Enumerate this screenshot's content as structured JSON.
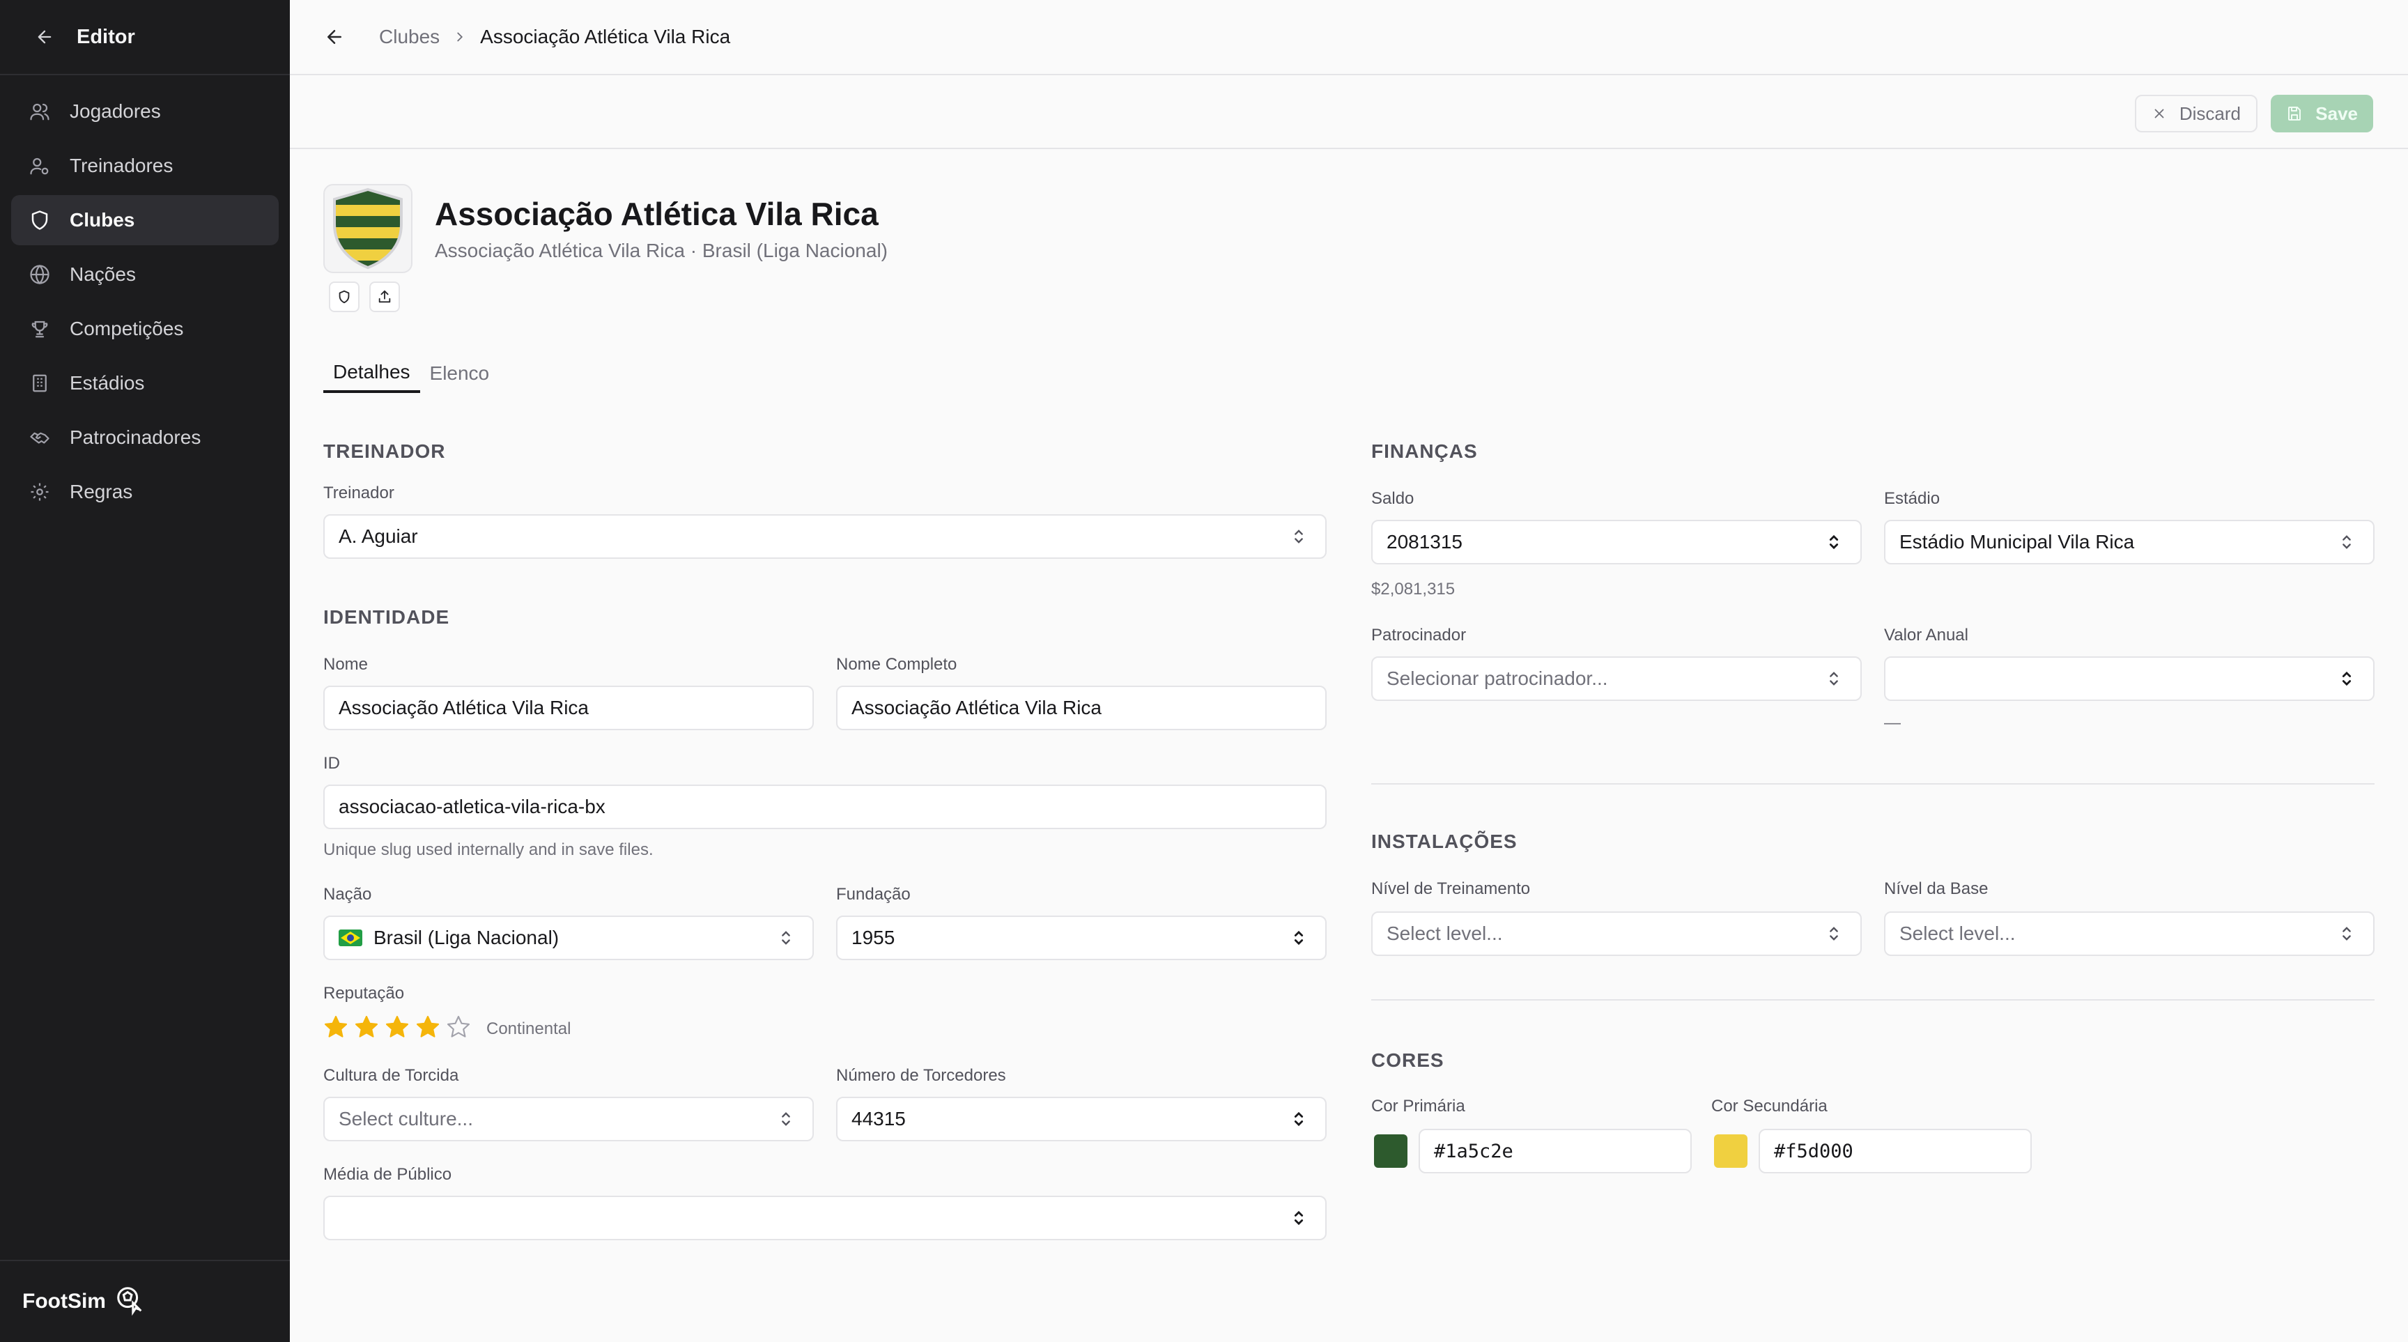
{
  "sidebar": {
    "title": "Editor",
    "items": [
      {
        "label": "Jogadores",
        "icon": "users-icon"
      },
      {
        "label": "Treinadores",
        "icon": "user-cog-icon"
      },
      {
        "label": "Clubes",
        "icon": "shield-icon",
        "active": true
      },
      {
        "label": "Nações",
        "icon": "globe-icon"
      },
      {
        "label": "Competições",
        "icon": "trophy-icon"
      },
      {
        "label": "Estádios",
        "icon": "building-icon"
      },
      {
        "label": "Patrocinadores",
        "icon": "handshake-icon"
      },
      {
        "label": "Regras",
        "icon": "gear-icon"
      }
    ],
    "footer_brand": "FootSim"
  },
  "breadcrumb": {
    "parent": "Clubes",
    "current": "Associação Atlética Vila Rica"
  },
  "actions": {
    "discard": "Discard",
    "save": "Save"
  },
  "club": {
    "name": "Associação Atlética Vila Rica",
    "subtitle": "Associação Atlética Vila Rica · Brasil (Liga Nacional)",
    "crest_colors": [
      "#2d5a2d",
      "#f5d000"
    ]
  },
  "tabs": [
    {
      "label": "Detalhes",
      "active": true
    },
    {
      "label": "Elenco",
      "active": false
    }
  ],
  "treinador": {
    "section": "TREINADOR",
    "label": "Treinador",
    "value": "A. Aguiar"
  },
  "identidade": {
    "section": "IDENTIDADE",
    "nome_label": "Nome",
    "nome_value": "Associação Atlética Vila Rica",
    "nome_completo_label": "Nome Completo",
    "nome_completo_value": "Associação Atlética Vila Rica",
    "id_label": "ID",
    "id_value": "associacao-atletica-vila-rica-bx",
    "id_hint": "Unique slug used internally and in save files.",
    "nacao_label": "Nação",
    "nacao_value": "Brasil (Liga Nacional)",
    "fundacao_label": "Fundação",
    "fundacao_value": "1955",
    "reputacao_label": "Reputação",
    "reputacao_stars": 4,
    "reputacao_max": 5,
    "reputacao_text": "Continental",
    "cultura_label": "Cultura de Torcida",
    "cultura_placeholder": "Select culture...",
    "torcedores_label": "Número de Torcedores",
    "torcedores_value": "44315",
    "publico_label": "Média de Público",
    "publico_value": ""
  },
  "financas": {
    "section": "FINANÇAS",
    "saldo_label": "Saldo",
    "saldo_value": "2081315",
    "saldo_formatted": "$2,081,315",
    "estadio_label": "Estádio",
    "estadio_value": "Estádio Municipal Vila Rica",
    "patrocinador_label": "Patrocinador",
    "patrocinador_placeholder": "Selecionar patrocinador...",
    "valor_label": "Valor Anual",
    "valor_value": "",
    "valor_hint": "—"
  },
  "instalacoes": {
    "section": "INSTALAÇÕES",
    "treino_label": "Nível de Treinamento",
    "treino_placeholder": "Select level...",
    "base_label": "Nível da Base",
    "base_placeholder": "Select level..."
  },
  "cores": {
    "section": "CORES",
    "primaria_label": "Cor Primária",
    "primaria_value": "#1a5c2e",
    "secundaria_label": "Cor Secundária",
    "secundaria_value": "#f5d000",
    "primaria_swatch": "#2d5a2d",
    "secundaria_swatch": "#f0d040"
  }
}
